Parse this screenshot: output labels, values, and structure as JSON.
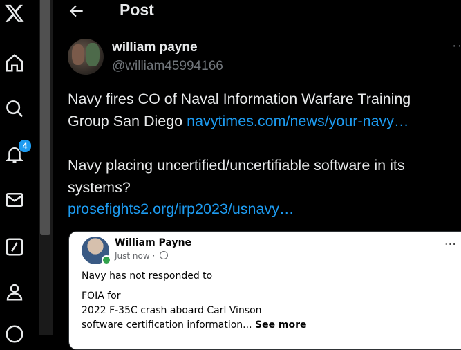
{
  "header": {
    "title": "Post"
  },
  "nav": {
    "notifications_badge": "4"
  },
  "tweet": {
    "author_name": "william payne",
    "author_handle": "@william45994166",
    "text_line1": "Navy fires CO of Naval Information Warfare Training Group San Diego",
    "link1": "navytimes.com/news/your-navy…",
    "text_line2": "Navy placing uncertified/uncertifiable software in its systems?",
    "link2": "prosefights2.org/irp2023/usnavy…"
  },
  "card": {
    "name": "William Payne",
    "time": "Just now ·",
    "line1": "Navy has not responded to",
    "line2": "FOIA for",
    "line3": "2022 F-35C crash aboard Carl Vinson",
    "line4": "software certification information...",
    "see_more": "See more"
  },
  "colors": {
    "accent": "#1d9bf0",
    "background": "#000000",
    "muted": "#71767b"
  }
}
